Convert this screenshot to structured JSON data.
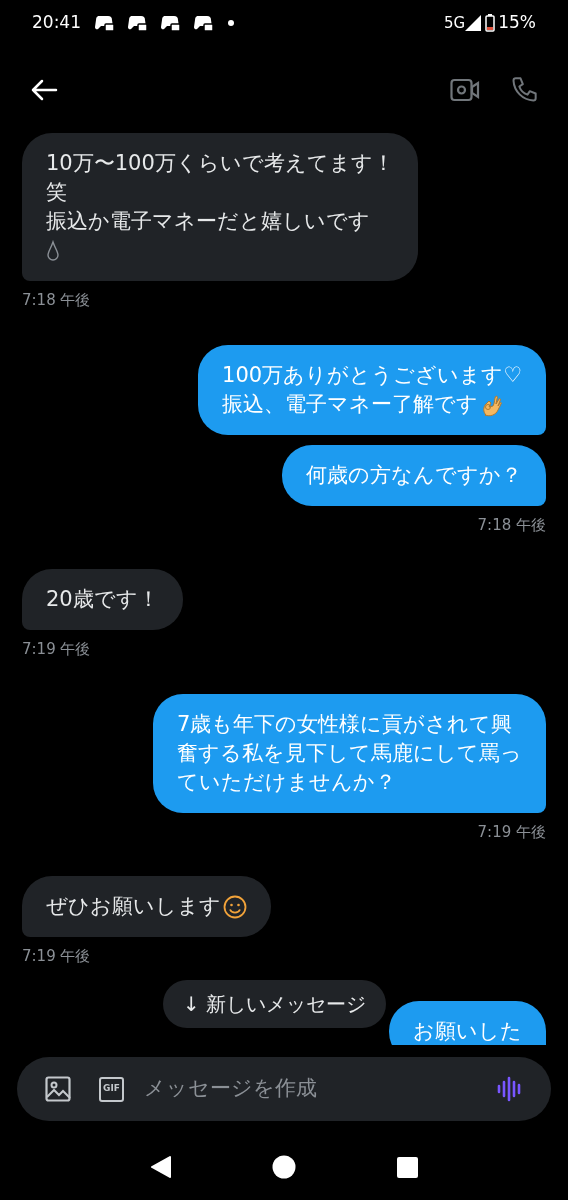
{
  "status_bar": {
    "time": "20:41",
    "network": "5G",
    "battery": "15%"
  },
  "messages": [
    {
      "outgoing": false,
      "bubbles": [
        {
          "kind": "drop",
          "lines": [
            "10万〜100万くらいで考えてます！",
            "笑",
            "振込か電子マネーだと嬉しいです"
          ]
        }
      ],
      "time": "7:18 午後"
    },
    {
      "outgoing": true,
      "bubbles": [
        {
          "kind": "okhand",
          "lines": [
            "100万ありがとうございます♡",
            "振込、電子マネー了解です"
          ]
        },
        {
          "kind": "plain",
          "lines": [
            "何歳の方なんですか？"
          ]
        }
      ],
      "time": "7:18 午後"
    },
    {
      "outgoing": false,
      "bubbles": [
        {
          "kind": "plain",
          "lines": [
            "20歳です！"
          ]
        }
      ],
      "time": "7:19 午後"
    },
    {
      "outgoing": true,
      "bubbles": [
        {
          "kind": "plain",
          "lines": [
            "7歳も年下の女性様に貢がされて興",
            "奮する私を見下して馬鹿にして罵っ",
            "ていただけませんか？"
          ]
        }
      ],
      "time": "7:19 午後"
    },
    {
      "outgoing": false,
      "bubbles": [
        {
          "kind": "smiley",
          "lines": [
            "ぜひお願いします"
          ]
        }
      ],
      "time": "7:19 午後"
    },
    {
      "outgoing": true,
      "bubbles": [
        {
          "kind": "plain",
          "lines": [
            "お願いした"
          ]
        }
      ]
    }
  ],
  "new_messages_pill": "↓ 新しいメッセージ",
  "composer": {
    "gif": "GIF",
    "placeholder": "メッセージを作成"
  }
}
